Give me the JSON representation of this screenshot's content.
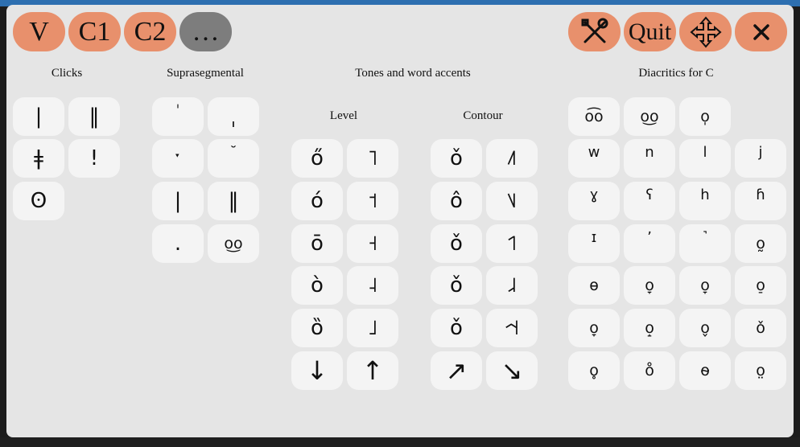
{
  "toolbar": {
    "left_buttons": [
      {
        "label": "V"
      },
      {
        "label": "C1"
      },
      {
        "label": "C2"
      },
      {
        "label": "…"
      }
    ],
    "quit_label": "Quit",
    "icons": [
      "tools-icon",
      "quit-button",
      "move-icon",
      "close-icon"
    ]
  },
  "sections": {
    "clicks": {
      "title": "Clicks",
      "keys": [
        "|",
        "‖",
        "ǂ",
        "!",
        "ʘ"
      ]
    },
    "suprasegmental": {
      "title": "Suprasegmental",
      "keys": [
        "ˈ",
        "ˌ",
        "ˑ",
        "˘",
        "|",
        "‖",
        ".",
        "o͜o"
      ]
    },
    "tones": {
      "title": "Tones and word accents",
      "level_title": "Level",
      "contour_title": "Contour",
      "level_keys": [
        "ő",
        "˥",
        "ó",
        "˦",
        "ō",
        "˧",
        "ò",
        "˨",
        "ȍ",
        "˩",
        "↓",
        "↑"
      ],
      "contour_keys": [
        "ǒ",
        "˩˥",
        "ô",
        "˥˩",
        "ǒ",
        "˦˥",
        "ǒ",
        "˩˨",
        "ǒ",
        "˧˦˧",
        "↗",
        "↘"
      ]
    },
    "diacritics": {
      "title": "Diacritics for C",
      "keys": [
        "o͡o",
        "o͜o",
        "o̩",
        "w",
        "n",
        "l",
        "j",
        "ɣ",
        "ʕ",
        "h",
        "ɦ",
        "ɪ",
        "ʼ",
        "˺",
        "o̰",
        "ɵ",
        "o̞",
        "o̞",
        "o̠",
        "o̞",
        "o̝",
        "o̬",
        "ǒ",
        "o̥",
        "o̊",
        "o̴",
        "o̤"
      ]
    }
  }
}
